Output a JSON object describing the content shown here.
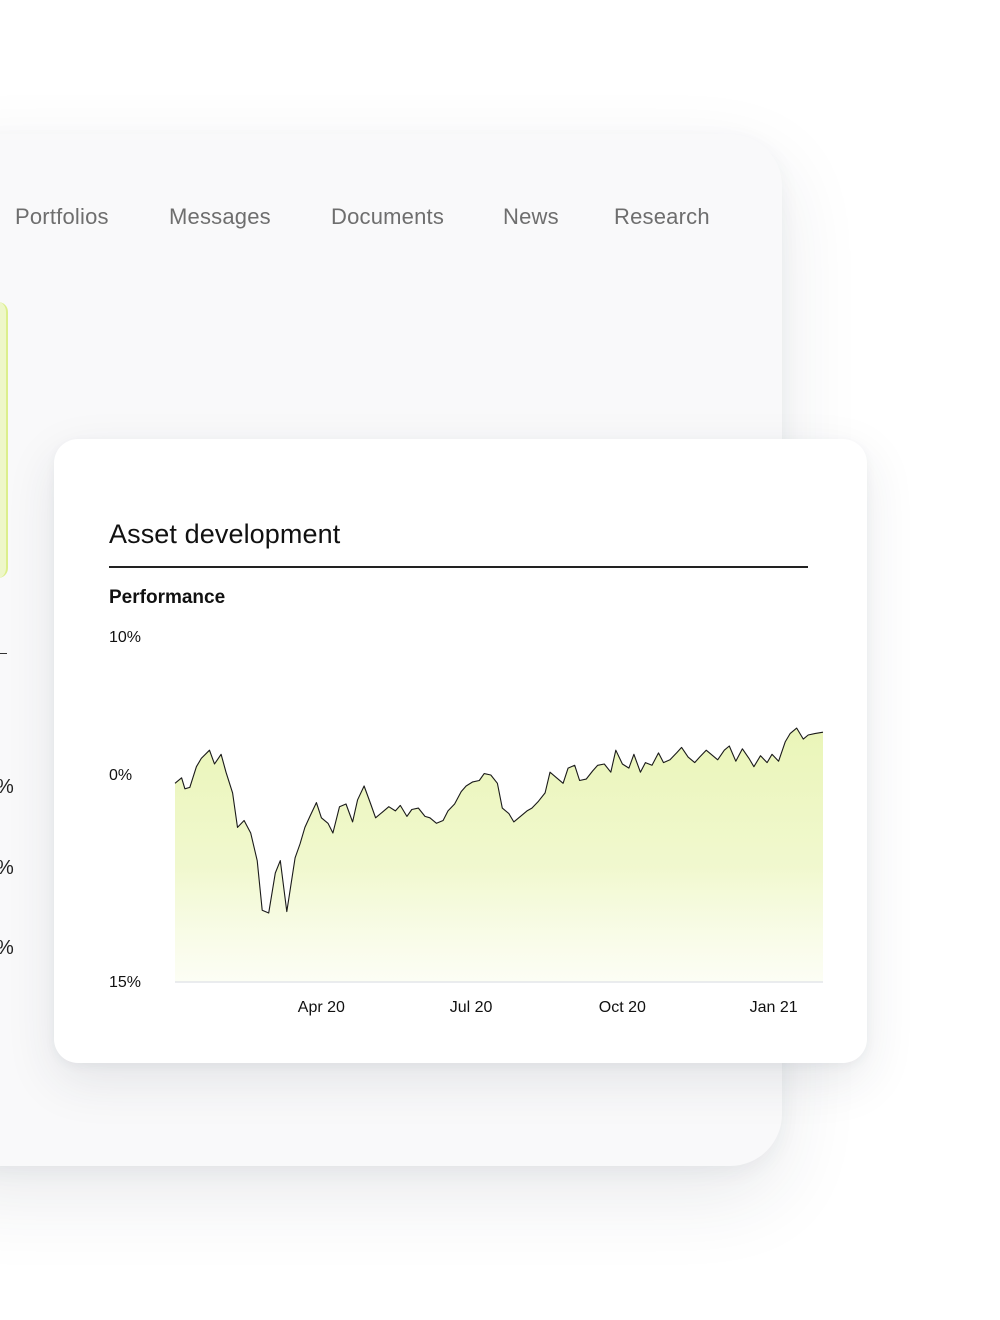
{
  "nav": {
    "items": [
      {
        "id": "portfolios",
        "label": "Portfolios"
      },
      {
        "id": "messages",
        "label": "Messages"
      },
      {
        "id": "documents",
        "label": "Documents"
      },
      {
        "id": "news",
        "label": "News"
      },
      {
        "id": "research",
        "label": "Research"
      }
    ]
  },
  "left_fragments": [
    "%",
    "%",
    "%"
  ],
  "card": {
    "title": "Asset development",
    "subtitle": "Performance"
  },
  "colors": {
    "accent": "#dcef8c",
    "fill_top": "#eaf5b8",
    "line": "#1a1a1a"
  },
  "chart_data": {
    "type": "area",
    "title": "",
    "xlabel": "",
    "ylabel": "",
    "y_tick_labels": [
      {
        "label": "10%",
        "value": 10
      },
      {
        "label": "0%",
        "value": 0
      },
      {
        "label": "15%",
        "value": -15
      }
    ],
    "ylim": [
      -15,
      10
    ],
    "x_tick_labels": [
      {
        "label": "Apr 20",
        "date": "2020-04-01"
      },
      {
        "label": "Jul 20",
        "date": "2020-07-01"
      },
      {
        "label": "Oct 20",
        "date": "2020-10-01"
      },
      {
        "label": "Jan 21",
        "date": "2021-01-01"
      }
    ],
    "xlim": [
      "2020-01-03",
      "2021-01-31"
    ],
    "grid": false,
    "series": [
      {
        "x": [
          "2020-01-03",
          "2020-01-07",
          "2020-01-09",
          "2020-01-12",
          "2020-01-16",
          "2020-01-19",
          "2020-01-24",
          "2020-01-27",
          "2020-01-31",
          "2020-02-03",
          "2020-02-07",
          "2020-02-10",
          "2020-02-14",
          "2020-02-18",
          "2020-02-22",
          "2020-02-25",
          "2020-02-29",
          "2020-03-04",
          "2020-03-07",
          "2020-03-11",
          "2020-03-16",
          "2020-03-19",
          "2020-03-22",
          "2020-03-25",
          "2020-03-29",
          "2020-04-01",
          "2020-04-05",
          "2020-04-08",
          "2020-04-12",
          "2020-04-16",
          "2020-04-20",
          "2020-04-23",
          "2020-04-27",
          "2020-05-01",
          "2020-05-04",
          "2020-05-08",
          "2020-05-12",
          "2020-05-16",
          "2020-05-19",
          "2020-05-23",
          "2020-05-26",
          "2020-05-30",
          "2020-06-03",
          "2020-06-06",
          "2020-06-10",
          "2020-06-14",
          "2020-06-17",
          "2020-06-21",
          "2020-06-25",
          "2020-06-28",
          "2020-07-02",
          "2020-07-06",
          "2020-07-09",
          "2020-07-13",
          "2020-07-17",
          "2020-07-20",
          "2020-07-24",
          "2020-07-27",
          "2020-07-31",
          "2020-08-04",
          "2020-08-07",
          "2020-08-11",
          "2020-08-15",
          "2020-08-18",
          "2020-08-22",
          "2020-08-26",
          "2020-08-29",
          "2020-09-02",
          "2020-09-05",
          "2020-09-09",
          "2020-09-13",
          "2020-09-16",
          "2020-09-20",
          "2020-09-24",
          "2020-09-27",
          "2020-10-01",
          "2020-10-05",
          "2020-10-08",
          "2020-10-12",
          "2020-10-15",
          "2020-10-19",
          "2020-10-23",
          "2020-10-26",
          "2020-10-30",
          "2020-11-03",
          "2020-11-06",
          "2020-11-10",
          "2020-11-14",
          "2020-11-17",
          "2020-11-21",
          "2020-11-25",
          "2020-11-28",
          "2020-12-02",
          "2020-12-05",
          "2020-12-09",
          "2020-12-13",
          "2020-12-17",
          "2020-12-20",
          "2020-12-24",
          "2020-12-28",
          "2020-12-31",
          "2021-01-04",
          "2021-01-08",
          "2021-01-11",
          "2021-01-15",
          "2021-01-19",
          "2021-01-22",
          "2021-01-26",
          "2021-01-31"
        ],
        "values": [
          -0.6,
          -0.2,
          -1.0,
          -0.9,
          0.6,
          1.2,
          1.8,
          0.8,
          1.5,
          0.2,
          -1.3,
          -3.8,
          -3.3,
          -4.2,
          -6.2,
          -9.8,
          -10.0,
          -7.1,
          -6.2,
          -9.9,
          -6.0,
          -5.0,
          -3.8,
          -3.0,
          -2.0,
          -3.1,
          -3.5,
          -4.2,
          -2.3,
          -2.1,
          -3.4,
          -1.8,
          -0.8,
          -2.1,
          -3.1,
          -2.7,
          -2.3,
          -2.6,
          -2.2,
          -3.0,
          -2.5,
          -2.4,
          -3.0,
          -3.1,
          -3.5,
          -3.3,
          -2.6,
          -2.1,
          -1.2,
          -0.8,
          -0.5,
          -0.4,
          0.1,
          0.0,
          -0.6,
          -2.4,
          -2.8,
          -3.4,
          -3.0,
          -2.6,
          -2.4,
          -1.9,
          -1.3,
          0.2,
          -0.2,
          -0.6,
          0.5,
          0.7,
          -0.4,
          -0.3,
          0.3,
          0.7,
          0.8,
          0.2,
          1.8,
          0.8,
          0.5,
          1.5,
          0.2,
          0.9,
          0.7,
          1.6,
          0.9,
          1.1,
          1.6,
          2.0,
          1.3,
          0.9,
          1.3,
          1.8,
          1.4,
          1.1,
          1.8,
          2.1,
          1.0,
          1.9,
          1.2,
          0.6,
          1.4,
          0.9,
          1.5,
          1.0,
          2.4,
          3.0,
          3.4,
          2.6,
          2.9,
          3.0,
          3.1
        ]
      }
    ]
  }
}
